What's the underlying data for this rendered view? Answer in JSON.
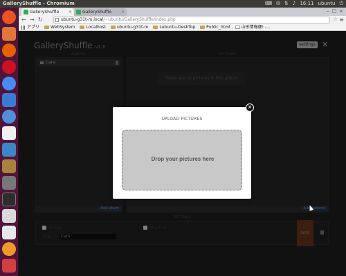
{
  "topbar": {
    "title": "GalleryShuffle - Chromium",
    "user": "ubuntu",
    "time": "16:11"
  },
  "browser": {
    "tabs": [
      {
        "label": "GalleryShuffle",
        "active": true
      },
      {
        "label": "GalleryShuffle",
        "active": false
      }
    ],
    "url_host": "ubuntu-g31t-m.local",
    "url_path": "/~ubuntu/GalleryShuffle/index.php",
    "bookmarks": [
      "アプリ",
      "WebSystem",
      "Localhost",
      "ubuntu-g31t-m",
      "Lubuntu-DeskTop",
      "Public_html",
      "山形情報便! -..."
    ]
  },
  "app": {
    "title": "GalleryShuffle",
    "version": "v1.0",
    "settings_label": "settings",
    "close_glyph": "✕",
    "albums_header": "ALBUMS",
    "pictures_header": "PICTURES",
    "settings_header": "SETTINGS",
    "album_name": "Cars",
    "no_pictures_text": "There are no pictures in this album",
    "add_album_label": "Add album",
    "add_pictures_label": "Add pictures",
    "active_label": "Active",
    "shuffled_label": "Shuffled",
    "title_label": "Title",
    "title_value": "Cars",
    "save_label": "SAVE"
  },
  "modal": {
    "title": "UPLOAD PICTURES",
    "dropzone_text": "Drop your pictures here",
    "close_glyph": "✕"
  },
  "colors": {
    "accent": "#3aa757",
    "save": "#7a3b21",
    "launcher": "#50153a"
  }
}
